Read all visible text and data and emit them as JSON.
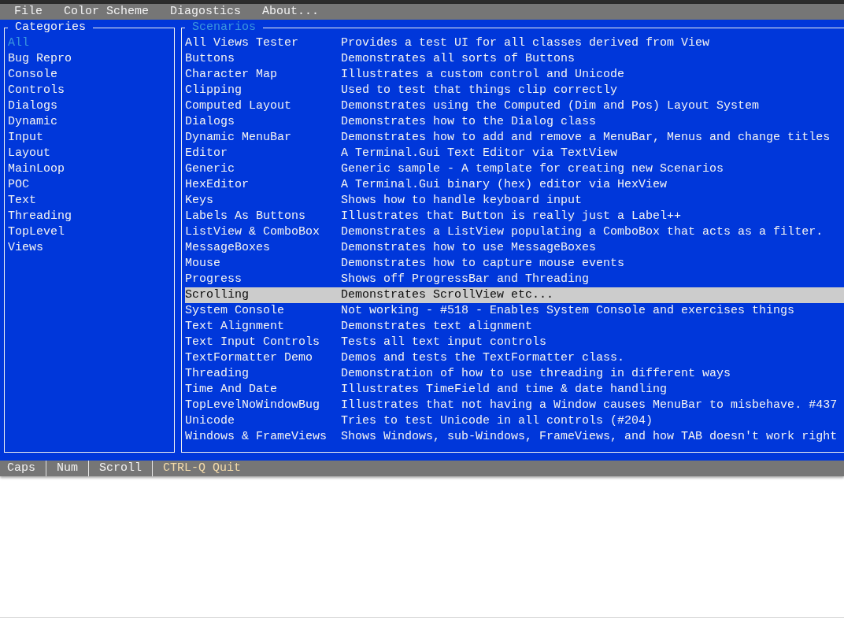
{
  "menu_bar": {
    "items": [
      "File",
      "Color Scheme",
      "Diagostics",
      "About..."
    ]
  },
  "categories": {
    "title": "Categories",
    "focused": false,
    "items": [
      {
        "label": "All",
        "selected": true
      },
      {
        "label": "Bug Repro",
        "selected": false
      },
      {
        "label": "Console",
        "selected": false
      },
      {
        "label": "Controls",
        "selected": false
      },
      {
        "label": "Dialogs",
        "selected": false
      },
      {
        "label": "Dynamic",
        "selected": false
      },
      {
        "label": "Input",
        "selected": false
      },
      {
        "label": "Layout",
        "selected": false
      },
      {
        "label": "MainLoop",
        "selected": false
      },
      {
        "label": "POC",
        "selected": false
      },
      {
        "label": "Text",
        "selected": false
      },
      {
        "label": "Threading",
        "selected": false
      },
      {
        "label": "TopLevel",
        "selected": false
      },
      {
        "label": "Views",
        "selected": false
      }
    ]
  },
  "scenarios": {
    "title": "Scenarios",
    "focused": true,
    "items": [
      {
        "name": "All Views Tester",
        "description": "Provides a test UI for all classes derived from View",
        "selected": false
      },
      {
        "name": "Buttons",
        "description": "Demonstrates all sorts of Buttons",
        "selected": false
      },
      {
        "name": "Character Map",
        "description": "Illustrates a custom control and Unicode",
        "selected": false
      },
      {
        "name": "Clipping",
        "description": "Used to test that things clip correctly",
        "selected": false
      },
      {
        "name": "Computed Layout",
        "description": "Demonstrates using the Computed (Dim and Pos) Layout System",
        "selected": false
      },
      {
        "name": "Dialogs",
        "description": "Demonstrates how to the Dialog class",
        "selected": false
      },
      {
        "name": "Dynamic MenuBar",
        "description": "Demonstrates how to add and remove a MenuBar, Menus and change titles",
        "selected": false
      },
      {
        "name": "Editor",
        "description": "A Terminal.Gui Text Editor via TextView",
        "selected": false
      },
      {
        "name": "Generic",
        "description": "Generic sample - A template for creating new Scenarios",
        "selected": false
      },
      {
        "name": "HexEditor",
        "description": "A Terminal.Gui binary (hex) editor via HexView",
        "selected": false
      },
      {
        "name": "Keys",
        "description": "Shows how to handle keyboard input",
        "selected": false
      },
      {
        "name": "Labels As Buttons",
        "description": "Illustrates that Button is really just a Label++",
        "selected": false
      },
      {
        "name": "ListView & ComboBox",
        "description": "Demonstrates a ListView populating a ComboBox that acts as a filter.",
        "selected": false
      },
      {
        "name": "MessageBoxes",
        "description": "Demonstrates how to use MessageBoxes",
        "selected": false
      },
      {
        "name": "Mouse",
        "description": "Demonstrates how to capture mouse events",
        "selected": false
      },
      {
        "name": "Progress",
        "description": "Shows off ProgressBar and Threading",
        "selected": false
      },
      {
        "name": "Scrolling",
        "description": "Demonstrates ScrollView etc...",
        "selected": true
      },
      {
        "name": "System Console",
        "description": "Not working - #518 - Enables System Console and exercises things",
        "selected": false
      },
      {
        "name": "Text Alignment",
        "description": "Demonstrates text alignment",
        "selected": false
      },
      {
        "name": "Text Input Controls",
        "description": "Tests all text input controls",
        "selected": false
      },
      {
        "name": "TextFormatter Demo",
        "description": "Demos and tests the TextFormatter class.",
        "selected": false
      },
      {
        "name": "Threading",
        "description": "Demonstration of how to use threading in different ways",
        "selected": false
      },
      {
        "name": "Time And Date",
        "description": "Illustrates TimeField and time & date handling",
        "selected": false
      },
      {
        "name": "TopLevelNoWindowBug",
        "description": "Illustrates that not having a Window causes MenuBar to misbehave. #437",
        "selected": false
      },
      {
        "name": "Unicode",
        "description": "Tries to test Unicode in all controls (#204)",
        "selected": false
      },
      {
        "name": "Windows & FrameViews",
        "description": "Shows Windows, sub-Windows, FrameViews, and how TAB doesn't work right",
        "selected": false
      }
    ]
  },
  "status_bar": {
    "items": [
      {
        "kind": "indicator",
        "label": "Caps"
      },
      {
        "kind": "indicator",
        "label": "Num"
      },
      {
        "kind": "indicator",
        "label": "Scroll"
      },
      {
        "kind": "shortcut",
        "label": "CTRL-Q Quit"
      }
    ]
  }
}
